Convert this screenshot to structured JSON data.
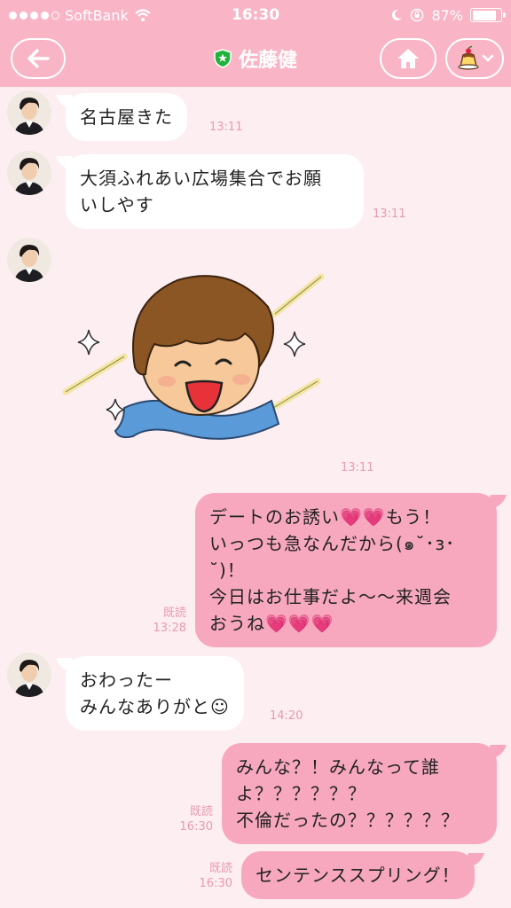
{
  "status": {
    "carrier": "SoftBank",
    "time": "16:30",
    "battery": "87%",
    "battery_level": 0.87
  },
  "header": {
    "title": "佐藤健"
  },
  "messages": [
    {
      "text": "名古屋きた",
      "time": "13:11"
    },
    {
      "text": "大須ふれあい広場集合でお願\nいしやす",
      "time": "13:11"
    },
    {
      "time": "13:11"
    },
    {
      "text": "デートのお誘い💗💗もう！\nいっつも急なんだから(๑˘･з･\n˘)！\n今日はお仕事だよ〜〜来週会\nおうね💗💗💗",
      "read": "既読",
      "time": "13:28"
    },
    {
      "text": "おわったー\nみんなありがと☺",
      "time": "14:20"
    },
    {
      "text": "みんな？！みんなって誰\nよ？？？？？？\n不倫だったの？？？？？？",
      "read": "既読",
      "time": "16:30"
    },
    {
      "text": "センテンススプリング！",
      "read": "既読",
      "time": "16:30"
    }
  ],
  "colors": {
    "accent": "#f9b5c6",
    "background": "#fdeef2",
    "outgoing_bubble": "#f7a8bf",
    "meta_text": "#e79bb0"
  }
}
